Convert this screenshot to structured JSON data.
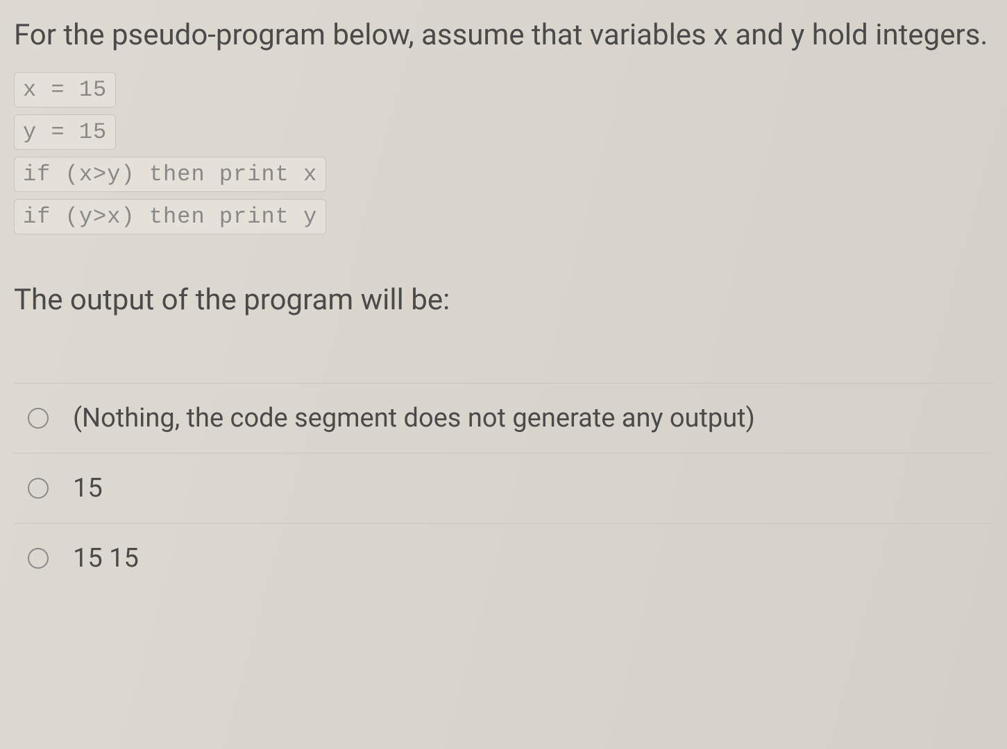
{
  "question": {
    "stem": "For the pseudo-program below, assume that variables x and y hold integers.",
    "code": {
      "line1": "x = 15",
      "line2": "y = 15",
      "line3": "if (x>y) then print x",
      "line4": "if (y>x) then print y"
    },
    "prompt": "The output of the program will be:"
  },
  "options": {
    "a": "(Nothing, the code segment does not generate any output)",
    "b": "15",
    "c": "15 15"
  }
}
